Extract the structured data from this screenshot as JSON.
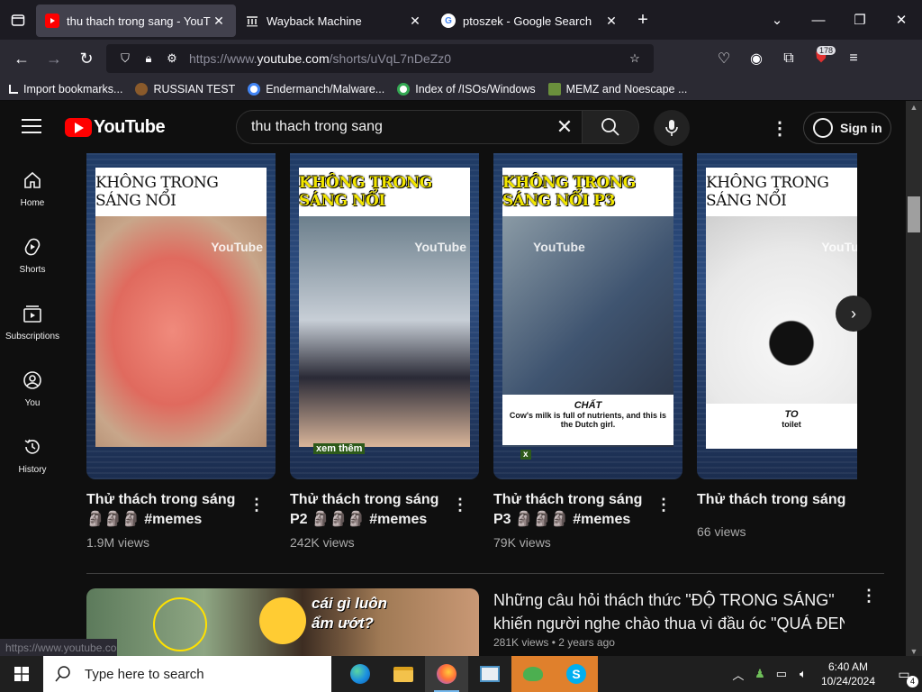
{
  "browser": {
    "tabs": [
      {
        "title": "thu thach trong sang - YouTube",
        "active": true,
        "favicon_color": "#ff0000"
      },
      {
        "title": "Wayback Machine",
        "active": false,
        "favicon_color": "#c0c0c0"
      },
      {
        "title": "ptoszek - Google Search",
        "active": false,
        "favicon_color": "#4285f4"
      }
    ],
    "url_prefix": "https://www.",
    "url_host": "youtube.com",
    "url_path": "/shorts/uVqL7nDeZz0",
    "extensions_badge": "178",
    "bookmarks": [
      {
        "label": "Import bookmarks...",
        "icon_color": "#fbfbfe"
      },
      {
        "label": "RUSSIAN TEST",
        "icon_color": "#8a5a2b"
      },
      {
        "label": "Endermanch/Malware...",
        "icon_color": "#f1f1f1"
      },
      {
        "label": "Index of /ISOs/Windows",
        "icon_color": "#f1f1f1"
      },
      {
        "label": "MEMZ and Noescape ...",
        "icon_color": "#6a8f3c"
      }
    ]
  },
  "youtube": {
    "logo_text": "YouTube",
    "search_value": "thu thach trong sang",
    "signin_label": "Sign in",
    "sidenav": [
      {
        "label": "Home",
        "icon": "home-icon"
      },
      {
        "label": "Shorts",
        "icon": "shorts-icon"
      },
      {
        "label": "Subscriptions",
        "icon": "subscriptions-icon"
      },
      {
        "label": "You",
        "icon": "you-icon"
      },
      {
        "label": "History",
        "icon": "history-icon"
      }
    ],
    "shorts": [
      {
        "caption": "KHÔNG TRONG SÁNG NỔI",
        "caption_style": "plain",
        "title": "Thử thách trong sáng 🗿🗿🗿 #memes",
        "views": "1.9M views",
        "watermark": "YouTube",
        "pic_color": "#e8766a",
        "sub_head": "",
        "sub_text": "",
        "bottom_label": ""
      },
      {
        "caption": "KHÔNG TRONG SÁNG NỔI",
        "caption_style": "yellow",
        "title": "Thử thách trong sáng P2 🗿🗿🗿 #memes",
        "views": "242K views",
        "watermark": "YouTube",
        "pic_color": "#9aa7b0",
        "sub_head": "",
        "sub_text": "",
        "bottom_label": "xem thêm"
      },
      {
        "caption": "KHÔNG TRONG SÁNG NỔI P3",
        "caption_style": "yellow",
        "title": "Thử thách trong sáng P3 🗿🗿🗿 #memes",
        "views": "79K views",
        "watermark": "YouTube",
        "pic_color": "#5d6f83",
        "sub_head": "CHẤT",
        "sub_text": "Cow's milk is full of nutrients, and this is the Dutch girl.",
        "bottom_label": "x"
      },
      {
        "caption": "KHÔNG TRONG SÁNG NỔI",
        "caption_style": "plain",
        "title": "Thử thách trong sáng",
        "views": "66 views",
        "watermark": "YouTube",
        "pic_color": "#eeeeee",
        "sub_head": "TO",
        "sub_text": "toilet",
        "bottom_label": ""
      }
    ],
    "video": {
      "thumb_text": "cái gì luôn ẩm ướt?",
      "title_line1": "Những câu hỏi thách thức \"ĐỘ TRONG SÁNG\"",
      "title_line2": "khiến người nghe chào thua vì đầu óc \"QUÁ ĐEN\"",
      "views": "281K views",
      "age": "2 years ago"
    },
    "status_url": "https://www.youtube.com"
  },
  "taskbar": {
    "search_placeholder": "Type here to search",
    "time": "6:40 AM",
    "date": "10/24/2024",
    "notification_count": "4"
  }
}
